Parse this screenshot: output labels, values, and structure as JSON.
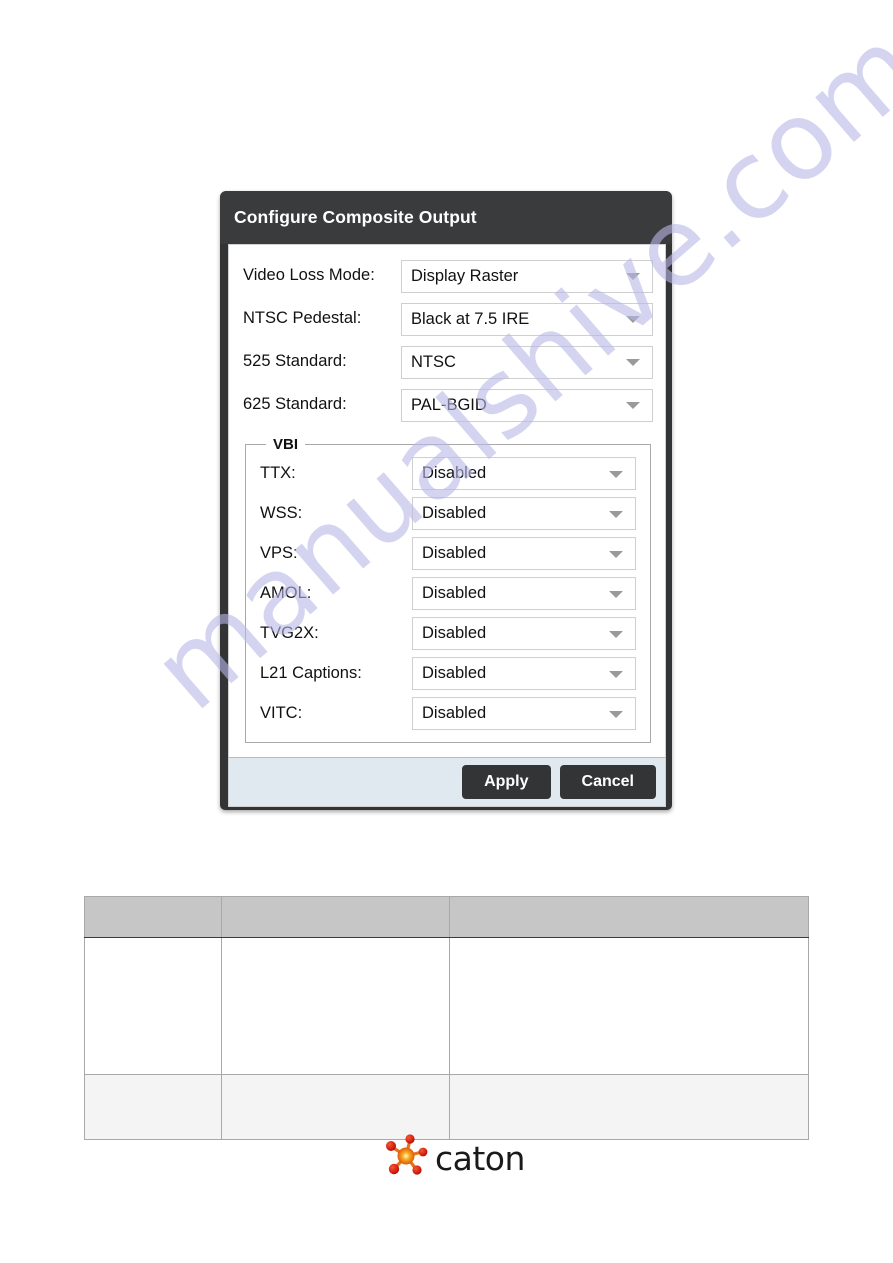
{
  "dialog": {
    "title": "Configure Composite Output",
    "fields": [
      {
        "label": "Video Loss Mode:",
        "value": "Display Raster",
        "name": "video-loss-mode"
      },
      {
        "label": "NTSC Pedestal:",
        "value": "Black at 7.5 IRE",
        "name": "ntsc-pedestal"
      },
      {
        "label": "525 Standard:",
        "value": "NTSC",
        "name": "525-standard"
      },
      {
        "label": "625 Standard:",
        "value": "PAL-BGID",
        "name": "625-standard"
      }
    ],
    "vbi": {
      "legend": "VBI",
      "fields": [
        {
          "label": "TTX:",
          "value": "Disabled",
          "name": "ttx"
        },
        {
          "label": "WSS:",
          "value": "Disabled",
          "name": "wss"
        },
        {
          "label": "VPS:",
          "value": "Disabled",
          "name": "vps"
        },
        {
          "label": "AMOL:",
          "value": "Disabled",
          "name": "amol"
        },
        {
          "label": "TVG2X:",
          "value": "Disabled",
          "name": "tvg2x"
        },
        {
          "label": "L21 Captions:",
          "value": "Disabled",
          "name": "l21-captions"
        },
        {
          "label": "VITC:",
          "value": "Disabled",
          "name": "vitc"
        }
      ]
    },
    "buttons": {
      "apply": "Apply",
      "cancel": "Cancel"
    },
    "colors": {
      "titlebar": "#3a3b3d",
      "footer": "#e0e9ef",
      "button": "#333436"
    }
  },
  "table": {
    "header": [
      "",
      "",
      ""
    ],
    "rows": [
      [
        "",
        "",
        ""
      ],
      [
        "",
        "",
        ""
      ]
    ]
  },
  "footer_logo": {
    "wordmark": "caton",
    "icon": "caton-molecule-icon",
    "colors": {
      "node": "#d81f12",
      "center": "#f5a623"
    }
  },
  "watermark": {
    "text": "manualshive.com",
    "color": "#b9b8e8"
  }
}
